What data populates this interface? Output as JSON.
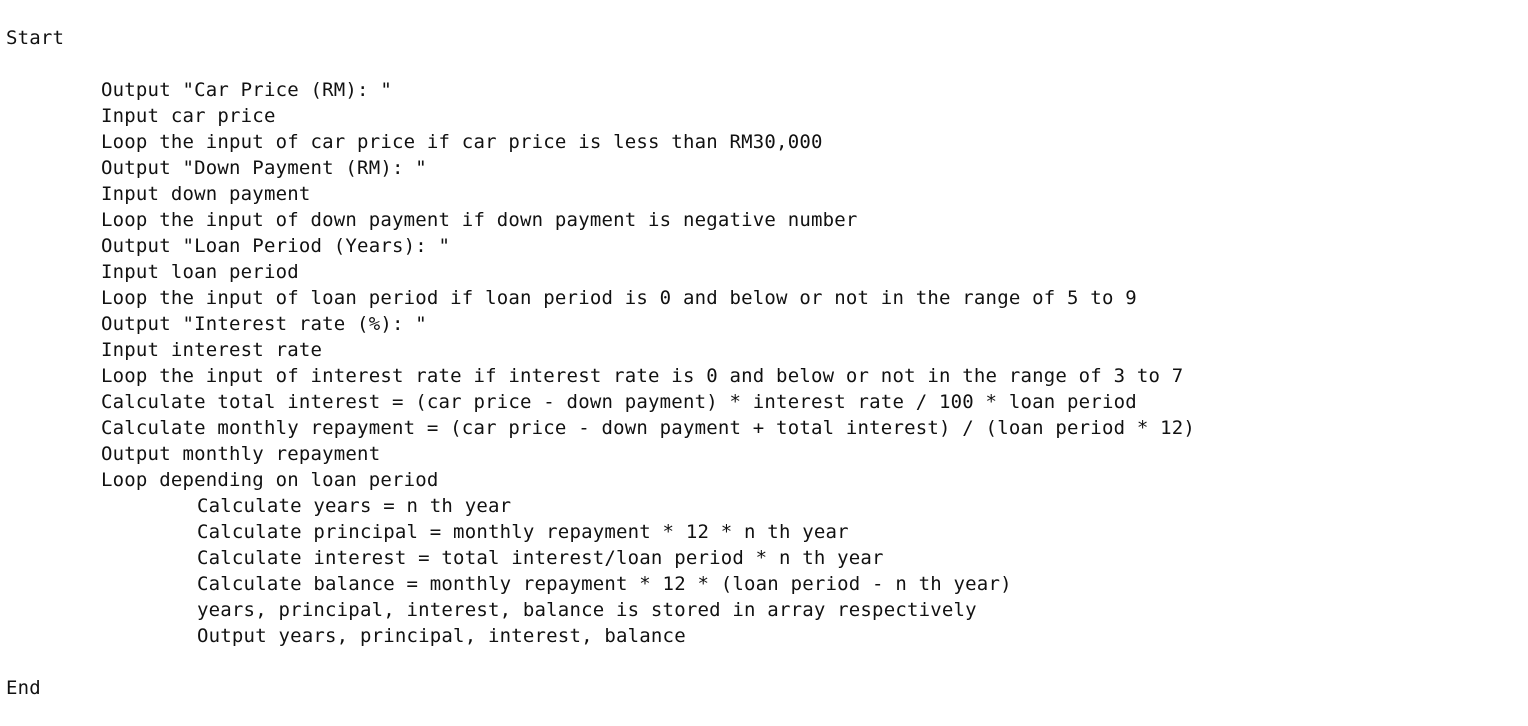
{
  "pseudocode": {
    "start": "Start",
    "main": [
      "Output \"Car Price (RM): \"",
      "Input car price",
      "Loop the input of car price if car price is less than RM30,000",
      "Output \"Down Payment (RM): \"",
      "Input down payment",
      "Loop the input of down payment if down payment is negative number",
      "Output \"Loan Period (Years): \"",
      "Input loan period",
      "Loop the input of loan period if loan period is 0 and below or not in the range of 5 to 9",
      "Output \"Interest rate (%): \"",
      "Input interest rate",
      "Loop the input of interest rate if interest rate is 0 and below or not in the range of 3 to 7",
      "Calculate total interest = (car price - down payment) * interest rate / 100 * loan period",
      "Calculate monthly repayment = (car price - down payment + total interest) / (loan period * 12)",
      "Output monthly repayment",
      "Loop depending on loan period"
    ],
    "loop_body": [
      "Calculate years = n th year",
      "Calculate principal = monthly repayment * 12 * n th year",
      "Calculate interest = total interest/loan period * n th year",
      "Calculate balance = monthly repayment * 12 * (loan period - n th year)",
      "years, principal, interest, balance is stored in array respectively",
      "Output years, principal, interest, balance"
    ],
    "end": "End"
  }
}
